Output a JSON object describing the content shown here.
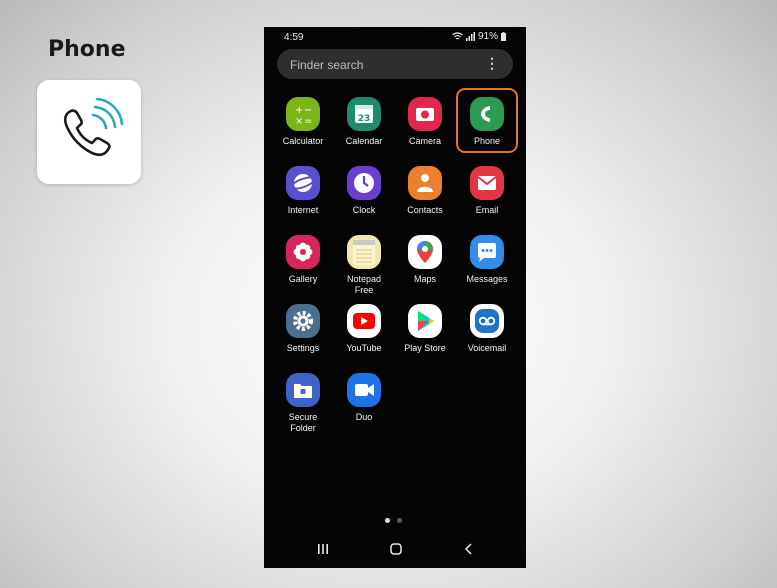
{
  "lesson": {
    "title": "Phone"
  },
  "status_bar": {
    "time": "4:59",
    "battery": "91%"
  },
  "search": {
    "placeholder": "Finder search"
  },
  "apps": [
    {
      "name": "Calculator",
      "icon": "calculator-icon",
      "color": "#7cb518"
    },
    {
      "name": "Calendar",
      "icon": "calendar-icon",
      "color": "#1f8a70",
      "badge": "23"
    },
    {
      "name": "Camera",
      "icon": "camera-icon",
      "color": "#e0284f"
    },
    {
      "name": "Phone",
      "icon": "phone-icon",
      "color": "#2e9a4f",
      "highlighted": true
    },
    {
      "name": "Internet",
      "icon": "internet-icon",
      "color": "#5a4fcf"
    },
    {
      "name": "Clock",
      "icon": "clock-icon",
      "color": "#6a3fd0"
    },
    {
      "name": "Contacts",
      "icon": "contacts-icon",
      "color": "#ee7f2d"
    },
    {
      "name": "Email",
      "icon": "email-icon",
      "color": "#e33644"
    },
    {
      "name": "Gallery",
      "icon": "gallery-icon",
      "color": "#d7265a"
    },
    {
      "name": "Notepad\nFree",
      "icon": "notepad-icon",
      "color": "#f3e7b2"
    },
    {
      "name": "Maps",
      "icon": "maps-icon",
      "color": "#ffffff"
    },
    {
      "name": "Messages",
      "icon": "messages-icon",
      "color": "#2f8ee8"
    },
    {
      "name": "Settings",
      "icon": "settings-icon",
      "color": "#4a6f8f"
    },
    {
      "name": "YouTube",
      "icon": "youtube-icon",
      "color": "#ffffff"
    },
    {
      "name": "Play Store",
      "icon": "play-store-icon",
      "color": "#ffffff"
    },
    {
      "name": "Voicemail",
      "icon": "voicemail-icon",
      "color": "#ffffff"
    },
    {
      "name": "Secure\nFolder",
      "icon": "secure-folder-icon",
      "color": "#3f63c9"
    },
    {
      "name": "Duo",
      "icon": "duo-icon",
      "color": "#1f73e8"
    }
  ],
  "highlight_color": "#e37622"
}
